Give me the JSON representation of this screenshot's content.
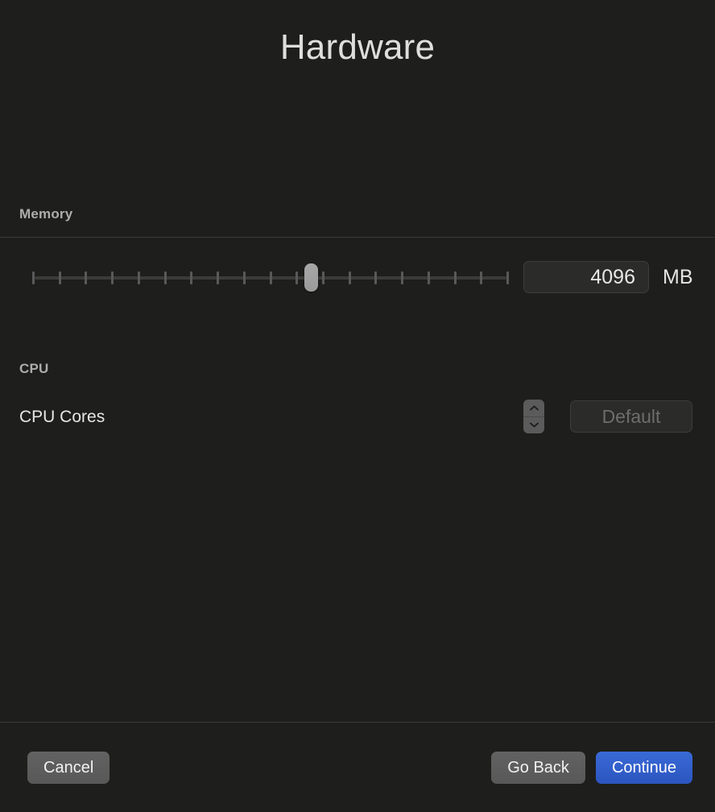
{
  "window": {
    "title": "Hardware",
    "background_color": "#1e1e1c"
  },
  "memory": {
    "section_label": "Memory",
    "slider": {
      "value": 4096,
      "tick_count": 19,
      "thumb_position_percent": 58.5,
      "min_label": "",
      "max_label": ""
    },
    "value_text": "4096",
    "unit": "MB"
  },
  "cpu": {
    "section_label": "CPU",
    "cores_label": "CPU Cores",
    "cores_value": "Default",
    "stepper": {
      "increment_icon": "chevron-up-icon",
      "decrement_icon": "chevron-down-icon"
    }
  },
  "footer": {
    "cancel_label": "Cancel",
    "go_back_label": "Go Back",
    "continue_label": "Continue",
    "accent_color": "#2f5fd0"
  }
}
